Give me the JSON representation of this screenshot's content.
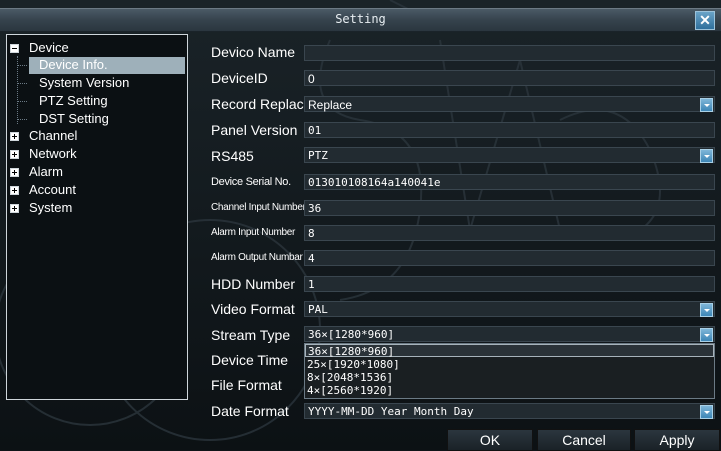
{
  "window": {
    "title": "Setting",
    "close_label": "✕"
  },
  "tree": {
    "items": [
      {
        "label": "Device",
        "state": "expanded"
      },
      {
        "label": "Device Info.",
        "state": "selected"
      },
      {
        "label": "System Version"
      },
      {
        "label": "PTZ Setting"
      },
      {
        "label": "DST Setting"
      },
      {
        "label": "Channel",
        "state": "collapsed"
      },
      {
        "label": "Network",
        "state": "collapsed"
      },
      {
        "label": "Alarm",
        "state": "collapsed"
      },
      {
        "label": "Account",
        "state": "collapsed"
      },
      {
        "label": "System",
        "state": "collapsed"
      }
    ]
  },
  "form": {
    "device_name": {
      "label": "Devico Name",
      "value": ""
    },
    "device_id": {
      "label": "DeviceID",
      "value": "0"
    },
    "record_replace": {
      "label": "Record Replace",
      "value": "Replace"
    },
    "panel_version": {
      "label": "Panel Version",
      "value": "01"
    },
    "rs485": {
      "label": "RS485",
      "value": "PTZ"
    },
    "serial": {
      "label": "Device Serial No.",
      "value": "013010108164a140041e"
    },
    "channel_input": {
      "label": "Channel Input Number",
      "value": "36"
    },
    "alarm_input": {
      "label": "Alarm Input Number",
      "value": "8"
    },
    "alarm_output": {
      "label": "Alarm Output Numbar",
      "value": "4"
    },
    "hdd": {
      "label": "HDD Number",
      "value": "1"
    },
    "video_format": {
      "label": "Video Format",
      "value": "PAL"
    },
    "stream_type": {
      "label": "Stream Type",
      "value": "36×[1280*960]"
    },
    "device_time": {
      "label": "Device Time"
    },
    "file_format": {
      "label": "File Format"
    },
    "date_format": {
      "label": "Date Format",
      "value": "YYYY-MM-DD Year Month Day"
    }
  },
  "stream_options": [
    "36×[1280*960]",
    "25×[1920*1080]",
    "8×[2048*1536]",
    "4×[2560*1920]"
  ],
  "buttons": {
    "ok": "OK",
    "cancel": "Cancel",
    "apply": "Apply"
  },
  "colors": {
    "accent": "#3d86b6",
    "selection": "#9eb0ba"
  }
}
